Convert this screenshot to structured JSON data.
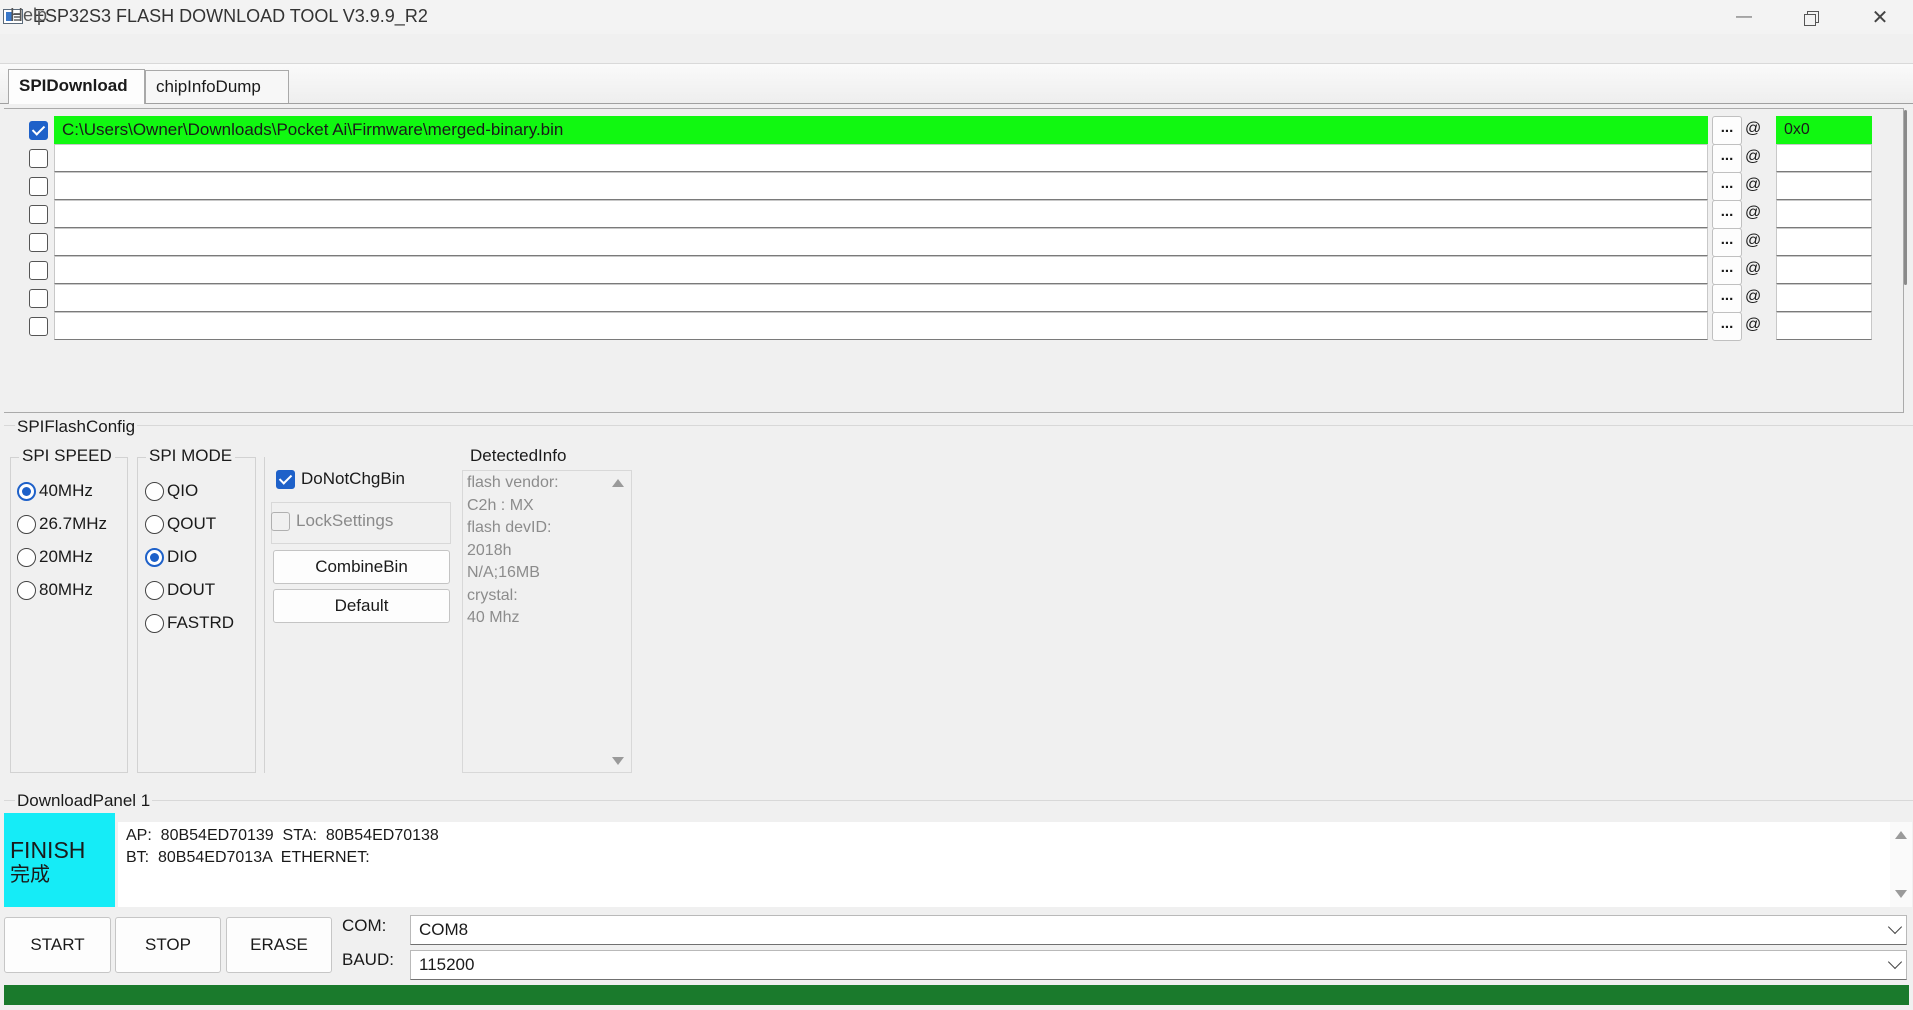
{
  "window": {
    "title": "ESP32S3 FLASH DOWNLOAD TOOL V3.9.9_R2",
    "minimize_glyph": "—",
    "close_glyph": "✕"
  },
  "menu": {
    "help": "Help"
  },
  "tabs": [
    {
      "label": "SPIDownload",
      "active": true
    },
    {
      "label": "chipInfoDump",
      "active": false
    }
  ],
  "file_list": {
    "browse_label": "...",
    "at_label": "@",
    "rows": [
      {
        "checked": true,
        "path": "C:\\Users\\Owner\\Downloads\\Pocket Ai\\Firmware\\merged-binary.bin",
        "address": "0x0"
      },
      {
        "checked": false,
        "path": "",
        "address": ""
      },
      {
        "checked": false,
        "path": "",
        "address": ""
      },
      {
        "checked": false,
        "path": "",
        "address": ""
      },
      {
        "checked": false,
        "path": "",
        "address": ""
      },
      {
        "checked": false,
        "path": "",
        "address": ""
      },
      {
        "checked": false,
        "path": "",
        "address": ""
      },
      {
        "checked": false,
        "path": "",
        "address": ""
      }
    ]
  },
  "spi_flash_config": {
    "title": "SPIFlashConfig",
    "spi_speed": {
      "title": "SPI SPEED",
      "options": [
        "40MHz",
        "26.7MHz",
        "20MHz",
        "80MHz"
      ],
      "selected": "40MHz"
    },
    "spi_mode": {
      "title": "SPI MODE",
      "options": [
        "QIO",
        "QOUT",
        "DIO",
        "DOUT",
        "FASTRD"
      ],
      "selected": "DIO"
    },
    "do_not_chg_bin": {
      "label": "DoNotChgBin",
      "checked": true
    },
    "lock_settings": {
      "label": "LockSettings",
      "checked": false,
      "disabled": true
    },
    "combine_bin_label": "CombineBin",
    "default_label": "Default",
    "detected_info": {
      "title": "DetectedInfo",
      "text": "flash vendor:\nC2h : MX\nflash devID:\n2018h\nN/A;16MB\ncrystal:\n40 Mhz"
    }
  },
  "download_panel": {
    "title": "DownloadPanel 1",
    "status_en": "FINISH",
    "status_cn": "完成",
    "status_color": "#15ecf7",
    "log_line1": "AP:  80B54ED70139  STA:  80B54ED70138",
    "log_line2": "BT:  80B54ED7013A  ETHERNET:",
    "start_label": "START",
    "stop_label": "STOP",
    "erase_label": "ERASE",
    "com_label": "COM:",
    "com_value": "COM8",
    "baud_label": "BAUD:",
    "baud_value": "115200",
    "progress_color": "#1a7a2c",
    "progress": 1.0
  },
  "colors": {
    "active_file": "#11f811",
    "accent": "#1e61c9"
  }
}
